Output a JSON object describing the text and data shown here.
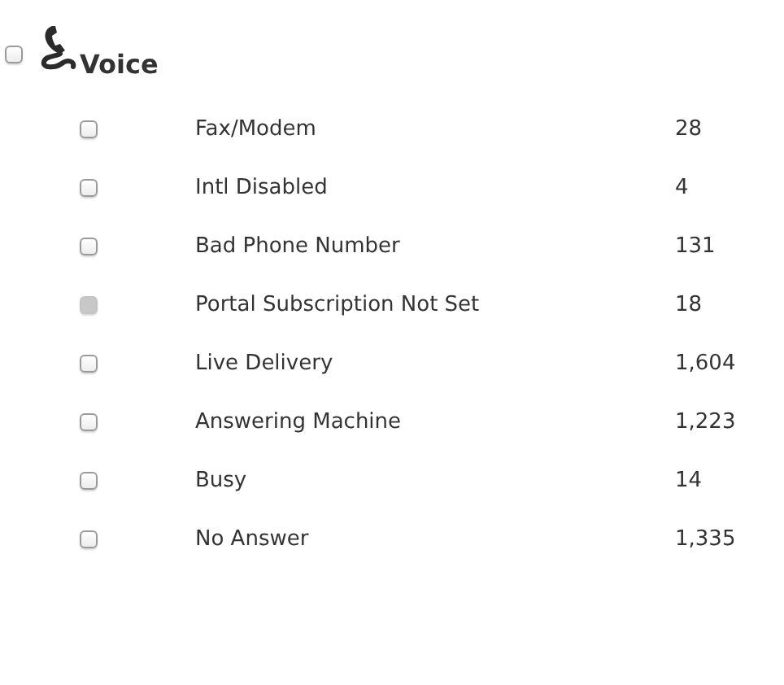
{
  "group": {
    "title": "Voice",
    "checked": false
  },
  "items": [
    {
      "label": "Fax/Modem",
      "count": "28",
      "checked": false,
      "disabled": false
    },
    {
      "label": "Intl Disabled",
      "count": "4",
      "checked": false,
      "disabled": false
    },
    {
      "label": "Bad Phone Number",
      "count": "131",
      "checked": false,
      "disabled": false
    },
    {
      "label": "Portal Subscription Not Set",
      "count": "18",
      "checked": false,
      "disabled": true
    },
    {
      "label": "Live Delivery",
      "count": "1,604",
      "checked": false,
      "disabled": false
    },
    {
      "label": "Answering Machine",
      "count": "1,223",
      "checked": false,
      "disabled": false
    },
    {
      "label": "Busy",
      "count": "14",
      "checked": false,
      "disabled": false
    },
    {
      "label": "No Answer",
      "count": "1,335",
      "checked": false,
      "disabled": false
    }
  ]
}
